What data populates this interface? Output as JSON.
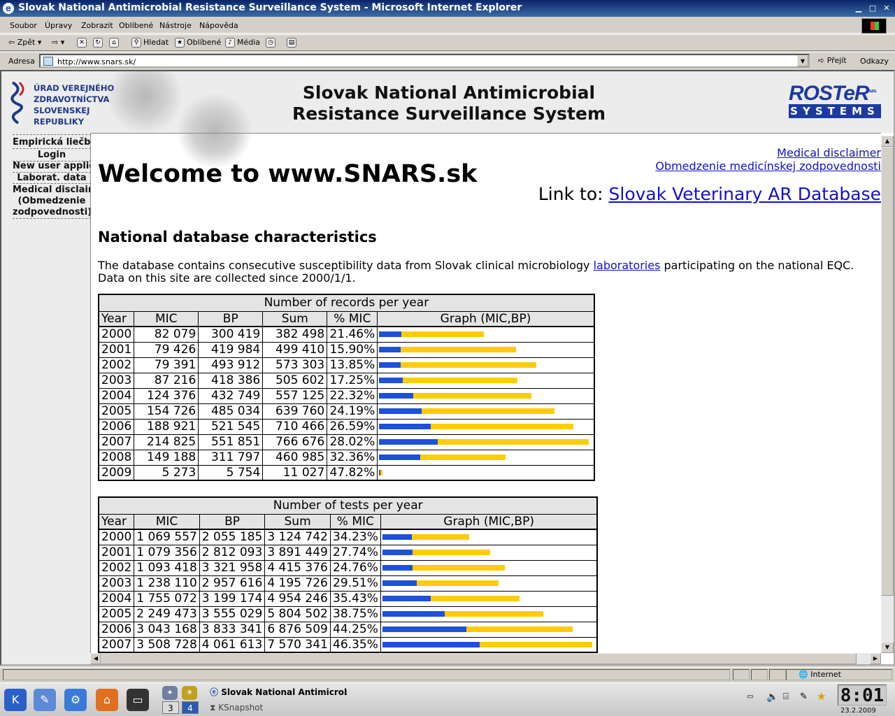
{
  "window": {
    "title": "Slovak National Antimicrobial Resistance Surveillance System - Microsoft Internet Explorer"
  },
  "menu": [
    "Soubor",
    "Úpravy",
    "Zobrazit",
    "Oblíbené",
    "Nástroje",
    "Nápověda"
  ],
  "toolbar": {
    "back": "Zpět",
    "search": "Hledat",
    "favorites": "Oblíbené",
    "media": "Média"
  },
  "address": {
    "label": "Adresa",
    "url": "http://www.snars.sk/",
    "go": "Přejít",
    "links": "Odkazy"
  },
  "header": {
    "logo_lines": [
      "ÚRAD VEREJNÉHO",
      "ZDRAVOTNÍCTVA",
      "SLOVENSKEJ",
      "REPUBLIKY"
    ],
    "title_line1": "Slovak National Antimicrobial",
    "title_line2": "Resistance Surveillance System",
    "brand_top": "ROSTeR",
    "brand_suffix": "s.r.o.",
    "brand_bottom": "SYSTEMS"
  },
  "nav": [
    "Empirická liečba",
    "Login",
    "New user application",
    "Laborat. data",
    "Medical disclaimer",
    "(Obmedzenie",
    "zodpovednosti)"
  ],
  "page": {
    "disclaimer_en": "Medical disclaimer",
    "disclaimer_sk": "Obmedzenie medicínskej zodpovednosti",
    "welcome": "Welcome to www.SNARS.sk",
    "link_to_label": "Link to:",
    "link_to_target": "Slovak Veterinary AR Database",
    "section_title": "National database characteristics",
    "desc_before": "The database contains consecutive susceptibility data from Slovak clinical microbiology ",
    "desc_link": "laboratories",
    "desc_after": " participating on the national EQC.",
    "desc_line2": "Data on this site are collected since 2000/1/1."
  },
  "tables": [
    {
      "caption": "Number of records per year",
      "columns": [
        "Year",
        "MIC",
        "BP",
        "Sum",
        "% MIC",
        "Graph (MIC,BP)"
      ],
      "rows": [
        [
          "2000",
          "82 079",
          "300 419",
          "382 498",
          "21.46%"
        ],
        [
          "2001",
          "79 426",
          "419 984",
          "499 410",
          "15.90%"
        ],
        [
          "2002",
          "79 391",
          "493 912",
          "573 303",
          "13.85%"
        ],
        [
          "2003",
          "87 216",
          "418 386",
          "505 602",
          "17.25%"
        ],
        [
          "2004",
          "124 376",
          "432 749",
          "557 125",
          "22.32%"
        ],
        [
          "2005",
          "154 726",
          "485 034",
          "639 760",
          "24.19%"
        ],
        [
          "2006",
          "188 921",
          "521 545",
          "710 466",
          "26.59%"
        ],
        [
          "2007",
          "214 825",
          "551 851",
          "766 676",
          "28.02%"
        ],
        [
          "2008",
          "149 188",
          "311 797",
          "460 985",
          "32.36%"
        ],
        [
          "2009",
          "5 273",
          "5 754",
          "11 027",
          "47.82%"
        ]
      ]
    },
    {
      "caption": "Number of tests per year",
      "columns": [
        "Year",
        "MIC",
        "BP",
        "Sum",
        "% MIC",
        "Graph (MIC,BP)"
      ],
      "rows": [
        [
          "2000",
          "1 069 557",
          "2 055 185",
          "3 124 742",
          "34.23%"
        ],
        [
          "2001",
          "1 079 356",
          "2 812 093",
          "3 891 449",
          "27.74%"
        ],
        [
          "2002",
          "1 093 418",
          "3 321 958",
          "4 415 376",
          "24.76%"
        ],
        [
          "2003",
          "1 238 110",
          "2 957 616",
          "4 195 726",
          "29.51%"
        ],
        [
          "2004",
          "1 755 072",
          "3 199 174",
          "4 954 246",
          "35.43%"
        ],
        [
          "2005",
          "2 249 473",
          "3 555 029",
          "5 804 502",
          "38.75%"
        ],
        [
          "2006",
          "3 043 168",
          "3 833 341",
          "6 876 509",
          "44.25%"
        ],
        [
          "2007",
          "3 508 728",
          "4 061 613",
          "7 570 341",
          "46.35%"
        ]
      ]
    }
  ],
  "colors": {
    "mic_bar": "#1e50d8",
    "bp_bar": "#ffcc00",
    "link": "#1010cc"
  },
  "statusbar": {
    "zone": "Internet"
  },
  "taskbar": {
    "pager": [
      "3",
      "4"
    ],
    "task_active": "Slovak National Antimicrobi",
    "task_other": "KSnapshot",
    "clock": "8:01",
    "date": "23.2.2009"
  }
}
